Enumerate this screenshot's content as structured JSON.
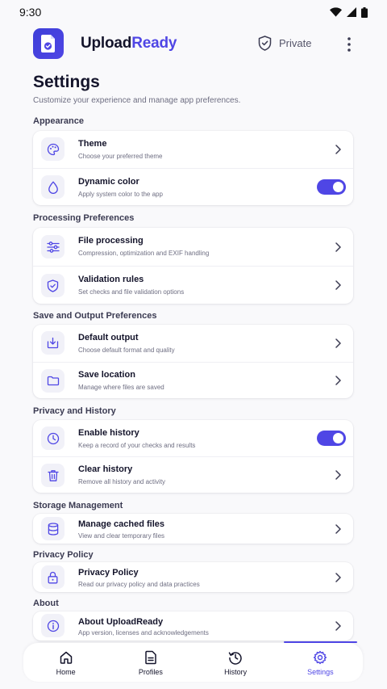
{
  "status": {
    "time": "9:30"
  },
  "header": {
    "app_name_part1": "Upload",
    "app_name_part2": "Ready",
    "privacy_label": "Private"
  },
  "page": {
    "title": "Settings",
    "subtitle": "Customize your experience and manage app preferences."
  },
  "sections": {
    "appearance": {
      "label": "Appearance",
      "items": [
        {
          "title": "Theme",
          "subtitle": "Choose your preferred theme"
        },
        {
          "title": "Dynamic color",
          "subtitle": "Apply system color to the app",
          "toggle": true
        }
      ]
    },
    "processing": {
      "label": "Processing Preferences",
      "items": [
        {
          "title": "File processing",
          "subtitle": "Compression, optimization and EXIF handling"
        },
        {
          "title": "Validation rules",
          "subtitle": "Set checks and file validation options"
        }
      ]
    },
    "save_output": {
      "label": "Save and Output Preferences",
      "items": [
        {
          "title": "Default output",
          "subtitle": "Choose default format and quality"
        },
        {
          "title": "Save location",
          "subtitle": "Manage where files are saved"
        }
      ]
    },
    "privacy_history": {
      "label": "Privacy and History",
      "items": [
        {
          "title": "Enable history",
          "subtitle": "Keep a record of your checks and results",
          "toggle": true
        },
        {
          "title": "Clear history",
          "subtitle": "Remove all history and activity"
        }
      ]
    },
    "storage": {
      "label": "Storage Management",
      "items": [
        {
          "title": "Manage cached files",
          "subtitle": "View and clear temporary files"
        }
      ]
    },
    "privacy_policy": {
      "label": "Privacy Policy",
      "items": [
        {
          "title": "Privacy Policy",
          "subtitle": "Read our privacy policy and data practices"
        }
      ]
    },
    "about": {
      "label": "About",
      "items": [
        {
          "title": "About UploadReady",
          "subtitle": "App version, licenses and acknowledgements"
        }
      ]
    }
  },
  "nav": {
    "items": [
      {
        "label": "Home"
      },
      {
        "label": "Profiles"
      },
      {
        "label": "History"
      },
      {
        "label": "Settings"
      }
    ],
    "active": "Settings"
  },
  "colors": {
    "accent": "#4f46e5",
    "background": "#f9f9fb",
    "card": "#ffffff"
  }
}
